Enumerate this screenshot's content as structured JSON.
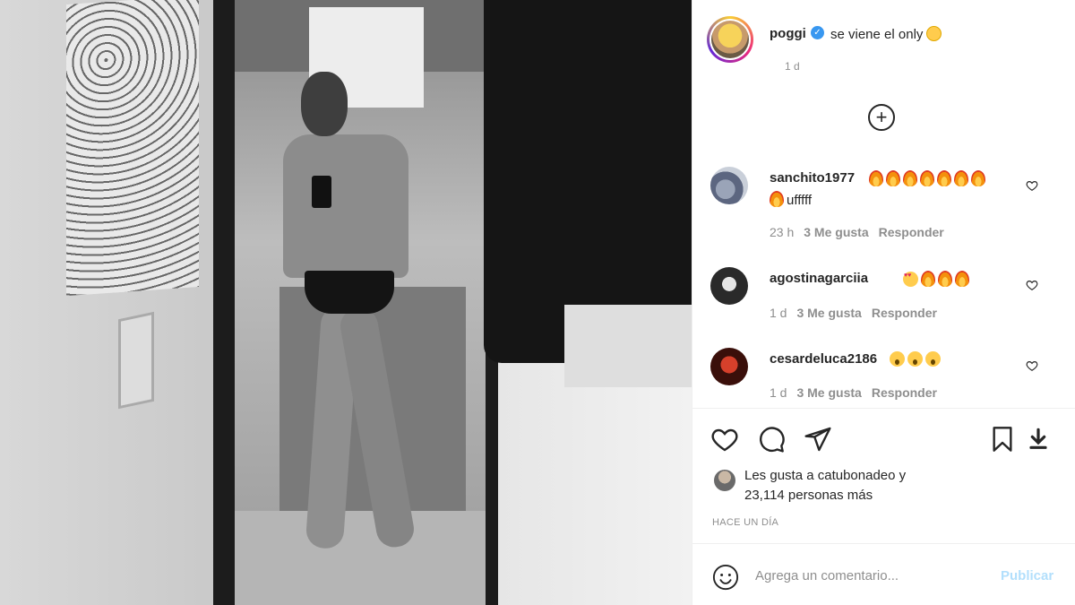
{
  "post": {
    "username": "poggi",
    "caption": "se viene el only",
    "caption_emoji": "flushed-face",
    "time": "1 d"
  },
  "comments": [
    {
      "username": "sanchito1977",
      "text_line2": "ufffff",
      "emoji": [
        "fire",
        "fire",
        "fire",
        "fire",
        "fire",
        "fire",
        "fire"
      ],
      "time": "23 h",
      "likes": "3 Me gusta",
      "reply": "Responder"
    },
    {
      "username": "agostinagarciia",
      "emoji": [
        "heart-eyes",
        "fire",
        "fire",
        "fire"
      ],
      "time": "1 d",
      "likes": "3 Me gusta",
      "reply": "Responder"
    },
    {
      "username": "cesardeluca2186",
      "emoji": [
        "wow",
        "wow",
        "wow"
      ],
      "time": "1 d",
      "likes": "3 Me gusta",
      "reply": "Responder"
    }
  ],
  "likes": {
    "prefix": "Les gusta a ",
    "user": "catubonadeo",
    "suffix": " y",
    "others": "23,114 personas más"
  },
  "timestamp": "HACE UN DÍA",
  "add_comment": {
    "placeholder": "Agrega un comentario...",
    "publish_label": "Publicar"
  },
  "colors": {
    "verified": "#3897f0",
    "secondary_text": "#8e8e8e",
    "publish_disabled": "#b2dffc"
  }
}
